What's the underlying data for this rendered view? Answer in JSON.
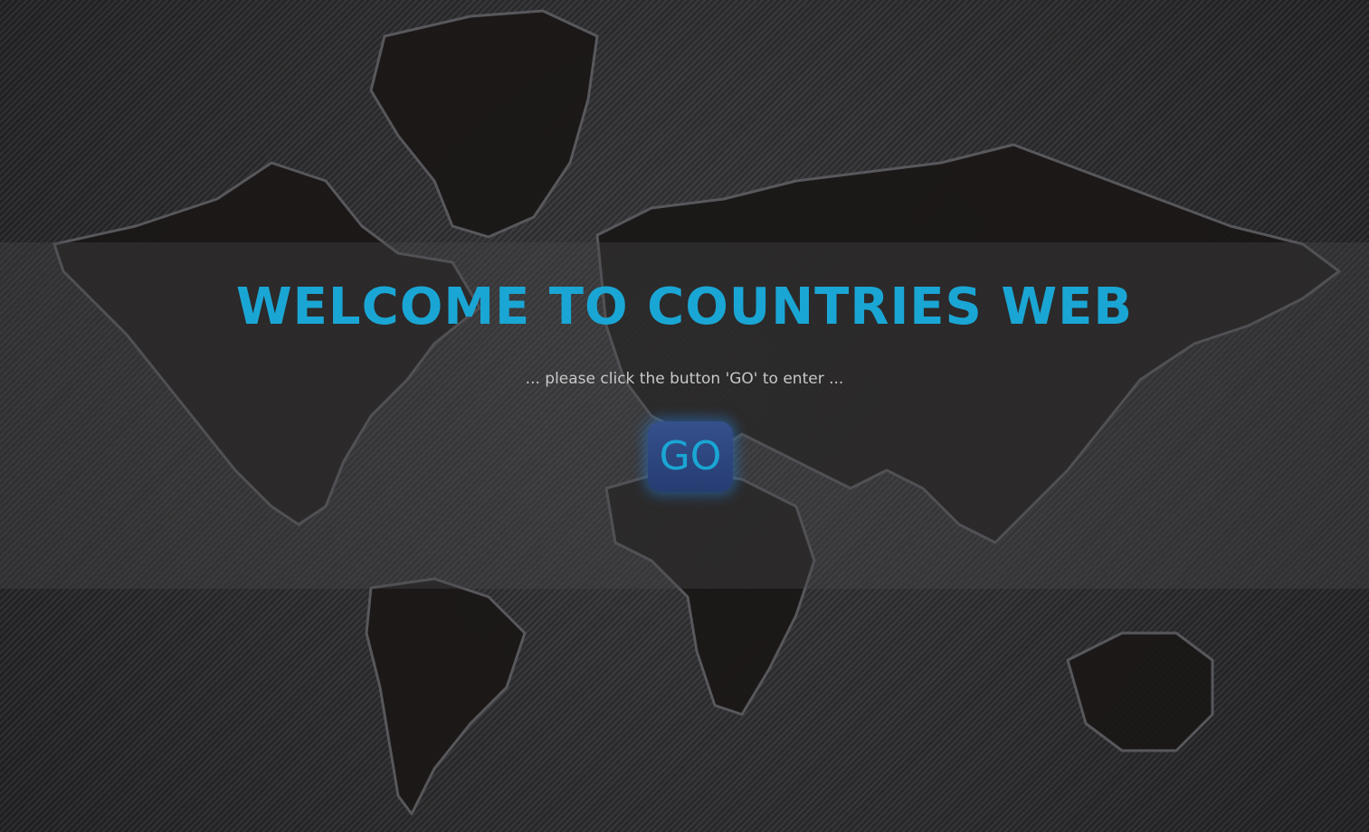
{
  "hero": {
    "title": "WELCOME TO COUNTRIES WEB",
    "subtitle": "... please click the button 'GO' to enter ...",
    "go_label": "GO"
  },
  "background": {
    "image": "world-map-carbon-texture"
  },
  "colors": {
    "accent": "#1aa6d4",
    "button": "#2c4580",
    "subtitle": "#c8c8c8"
  }
}
